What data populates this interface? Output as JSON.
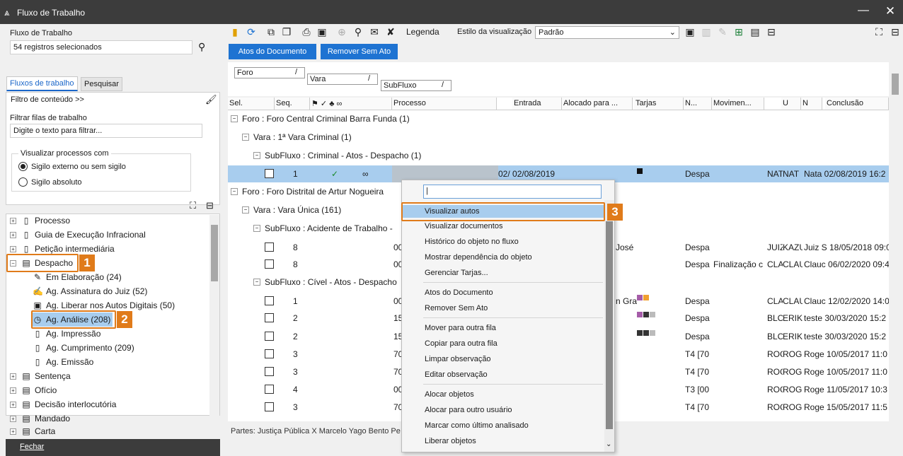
{
  "window": {
    "title": "Fluxo de Trabalho",
    "minimize_glyph": "—",
    "close_glyph": "✕"
  },
  "left": {
    "fluxo_label": "Fluxo de Trabalho",
    "fluxo_value": "54 registros selecionados",
    "tabs": [
      "Fluxos de trabalho",
      "Pesquisar"
    ],
    "filtro_conteudo": "Filtro de conteúdo >>",
    "filtrar_label": "Filtrar filas de trabalho",
    "filtrar_placeholder": "Digite o texto para filtrar...",
    "visualizar_label": "Visualizar processos com",
    "radio1": "Sigilo externo ou sem sigilo",
    "radio2": "Sigilo absoluto",
    "tree": [
      {
        "label": "Processo",
        "icon": "doc-icon"
      },
      {
        "label": "Guia de Execução Infracional",
        "icon": "doc-icon"
      },
      {
        "label": "Petição intermediária",
        "icon": "doc-icon"
      },
      {
        "label": "Despacho",
        "icon": "stack-icon"
      },
      {
        "label": "Em Elaboração (24)",
        "icon": "pen-icon"
      },
      {
        "label": "Ag. Assinatura do Juiz (52)",
        "icon": "sign-icon"
      },
      {
        "label": "Ag. Liberar nos Autos Digitais (50)",
        "icon": "doc-lock-icon"
      },
      {
        "label": "Ag. Análise (208)",
        "icon": "clock-icon"
      },
      {
        "label": "Ag. Impressão",
        "icon": "doc-icon"
      },
      {
        "label": "Ag. Cumprimento (209)",
        "icon": "doc-icon"
      },
      {
        "label": "Ag. Emissão",
        "icon": "doc-icon"
      },
      {
        "label": "Sentença",
        "icon": "stack-icon"
      },
      {
        "label": "Ofício",
        "icon": "stack-icon"
      },
      {
        "label": "Decisão interlocutória",
        "icon": "stack-icon"
      },
      {
        "label": "Mandado",
        "icon": "stack-icon"
      },
      {
        "label": "Carta",
        "icon": "stack-icon"
      }
    ],
    "badge1": "1",
    "badge2": "2",
    "fechar": "Fechar"
  },
  "toolbar": {
    "legenda": "Legenda",
    "estilo_label": "Estilo da visualização",
    "estilo_value": "Padrão",
    "btn_atos": "Atos do Documento",
    "btn_remover": "Remover Sem Ato"
  },
  "grouping": {
    "foro": "Foro",
    "vara": "Vara",
    "subfluxo": "SubFluxo"
  },
  "grid": {
    "headers": [
      "Sel.",
      "Seq.",
      "Processo",
      "Entrada",
      "Alocado para ...",
      "Tarjas",
      "N...",
      "Movimen...",
      "U",
      "N",
      "Conclusão"
    ],
    "groups": [
      "Foro : Foro Central Criminal Barra Funda  (1)",
      "Vara : 1ª Vara Criminal  (1)",
      "SubFluxo : Criminal - Atos - Despacho  (1)",
      "Foro : Foro Distrital de Artur Nogueira",
      "Vara : Vara Única  (161)",
      "SubFluxo : Acidente de Trabalho -",
      "SubFluxo : Cível - Atos - Despacho"
    ],
    "rows": [
      {
        "seq": "1",
        "processo": "",
        "entrada": "02/ 02/08/2019",
        "alocado": "",
        "n": "Despa",
        "mov": "",
        "u": "NAT",
        "n2": "NAT",
        "conc": "Nata 02/08/2019 16:2"
      },
      {
        "seq": "8",
        "processo": "00",
        "entrada": "",
        "alocado": "José",
        "n": "Despa",
        "mov": "",
        "u": "JUIZ",
        "n2": "KAZU",
        "conc": "Juiz S 18/05/2018 09:0"
      },
      {
        "seq": "8",
        "processo": "00",
        "entrada": "",
        "alocado": "",
        "n": "Despa",
        "mov": "Finalização c",
        "u": "CLA",
        "n2": "CLAU",
        "conc": "Clauc 06/02/2020 09:4"
      },
      {
        "seq": "1",
        "processo": "00",
        "entrada": "",
        "alocado": "n Gra",
        "n": "Despa",
        "mov": "",
        "u": "CLA",
        "n2": "CLAU",
        "conc": "Clauc 12/02/2020 14:0"
      },
      {
        "seq": "2",
        "processo": "15",
        "entrada": "",
        "alocado": "",
        "n": "Despa",
        "mov": "",
        "u": "BLC",
        "n2": "ERIK.",
        "conc": "teste 30/03/2020 15:2"
      },
      {
        "seq": "2",
        "processo": "15",
        "entrada": "",
        "alocado": "",
        "n": "Despa",
        "mov": "",
        "u": "BLC",
        "n2": "ERIK.",
        "conc": "teste 30/03/2020 15:2"
      },
      {
        "seq": "3",
        "processo": "70",
        "entrada": "",
        "alocado": "",
        "n": "T4 [70",
        "mov": "",
        "u": "ROG",
        "n2": "ROG",
        "conc": "Roge 10/05/2017 11:0"
      },
      {
        "seq": "3",
        "processo": "70",
        "entrada": "",
        "alocado": "",
        "n": "T4 [70",
        "mov": "",
        "u": "ROG",
        "n2": "ROG",
        "conc": "Roge 10/05/2017 11:0"
      },
      {
        "seq": "4",
        "processo": "00",
        "entrada": "",
        "alocado": "",
        "n": "T3 [00",
        "mov": "",
        "u": "ROG",
        "n2": "ROG",
        "conc": "Roge 11/05/2017 10:3"
      },
      {
        "seq": "3",
        "processo": "70",
        "entrada": "",
        "alocado": "",
        "n": "T4 [70",
        "mov": "",
        "u": "ROG",
        "n2": "ROG",
        "conc": "Roge 15/05/2017 11:5"
      }
    ],
    "footer": "Partes: Justiça Pública  X  Marcelo Yago Bento Pe"
  },
  "menu": {
    "items": [
      "Visualizar autos",
      "Visualizar documentos",
      "Histórico do objeto no fluxo",
      "Mostrar dependência do objeto",
      "Gerenciar Tarjas...",
      "Atos do Documento",
      "Remover Sem Ato",
      "Mover para outra fila",
      "Copiar para outra fila",
      "Limpar observação",
      "Editar observação",
      "Alocar objetos",
      "Alocar para outro usuário",
      "Marcar como último analisado",
      "Liberar objetos"
    ],
    "badge3": "3"
  },
  "colors": {
    "accent": "#1e73d2",
    "highlight": "#e07b1a",
    "selection": "#a8cdee",
    "titlebar": "#3c3c3c"
  }
}
